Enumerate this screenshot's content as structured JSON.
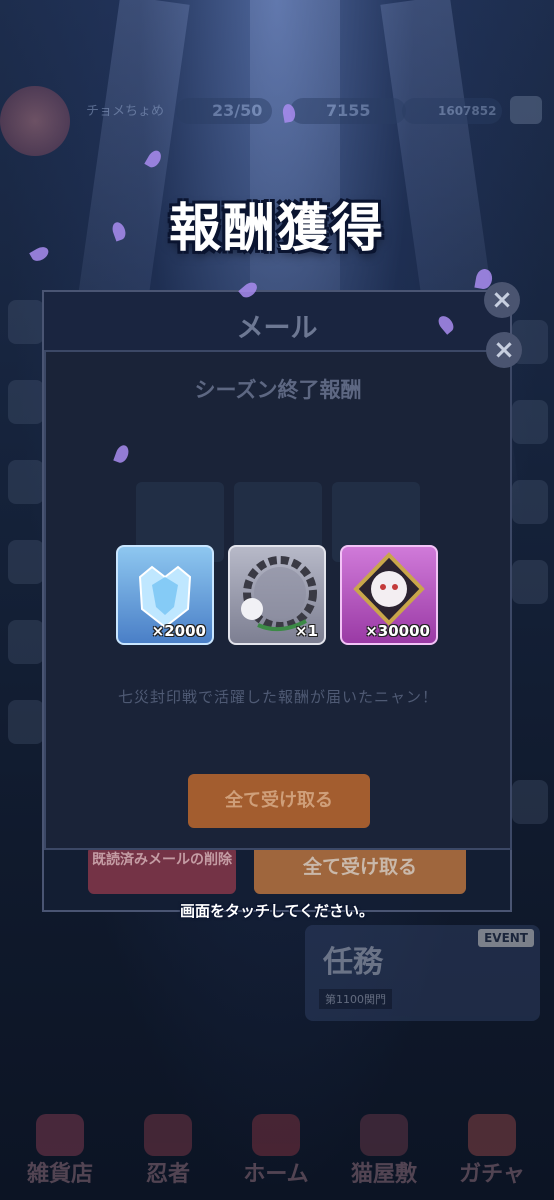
{
  "top_bar": {
    "player_name": "チョメちょめ",
    "stamina": "23/50",
    "gems": "7155",
    "coins": "1607852"
  },
  "headline": "報酬獲得",
  "mail_window": {
    "title": "メール",
    "delete_read_label": "既読済みメールの削除",
    "receive_all_label": "全て受け取る"
  },
  "reward_dialog": {
    "subtitle": "シーズン終了報酬",
    "message": "七災封印戦で活躍した報酬が届いたニャン！",
    "receive_all_label": "全て受け取る"
  },
  "rewards": [
    {
      "quantity": "×2000",
      "icon": "crystal-icon"
    },
    {
      "quantity": "×1",
      "icon": "ring-frame-icon"
    },
    {
      "quantity": "×30000",
      "icon": "character-medal-icon"
    }
  ],
  "touch_hint": "画面をタッチしてください。",
  "quest_panel": {
    "title": "任務",
    "subtitle": "第1100関門",
    "badge": "EVENT"
  },
  "bottom_nav": [
    {
      "label": "雑貨店"
    },
    {
      "label": "忍者"
    },
    {
      "label": "ホーム"
    },
    {
      "label": "猫屋敷"
    },
    {
      "label": "ガチャ"
    }
  ]
}
